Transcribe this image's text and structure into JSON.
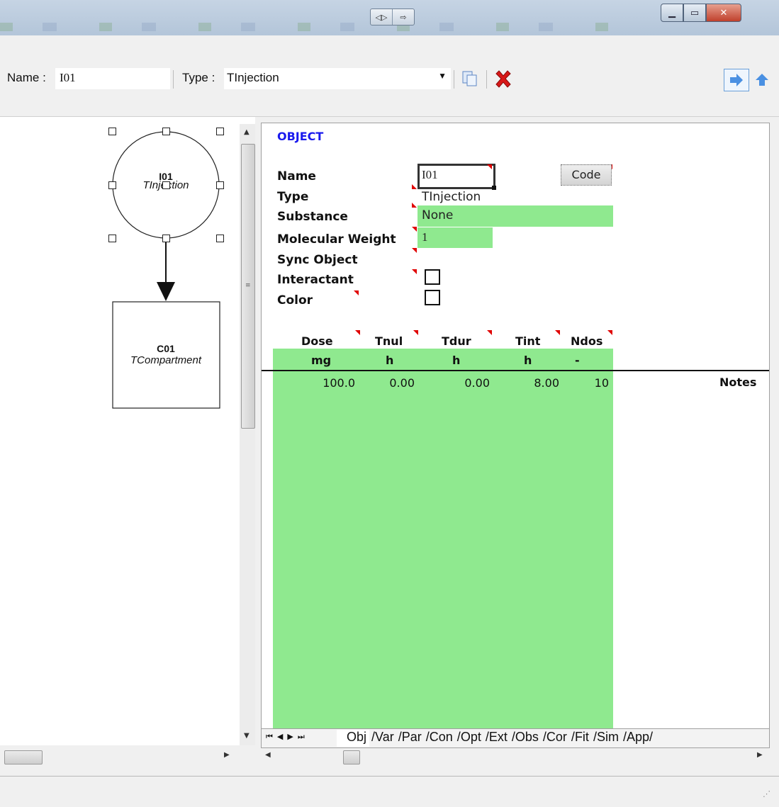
{
  "toolbar": {
    "name_label": "Name :",
    "name_value": "I01",
    "type_label": "Type :",
    "type_value": "TInjection"
  },
  "diagram": {
    "nodes": [
      {
        "id": "I01",
        "class": "TInjection"
      },
      {
        "id": "C01",
        "class": "TCompartment"
      }
    ]
  },
  "sheet": {
    "section": "OBJECT",
    "labels": {
      "name": "Name",
      "type": "Type",
      "substance": "Substance",
      "mw": "Molecular Weight",
      "sync": "Sync Object",
      "interactant": "Interactant",
      "color": "Color"
    },
    "values": {
      "name": "I01",
      "type": "TInjection",
      "substance": "None",
      "mw": "1"
    },
    "code_button": "Code",
    "dosing": {
      "headers": [
        "Dose",
        "Tnul",
        "Tdur",
        "Tint",
        "Ndos"
      ],
      "units": [
        "mg",
        "h",
        "h",
        "h",
        "-"
      ],
      "row": [
        "100.0",
        "0.00",
        "0.00",
        "8.00",
        "10"
      ]
    },
    "notes_label": "Notes"
  },
  "tabs": [
    "Obj",
    "Var",
    "Par",
    "Con",
    "Opt",
    "Ext",
    "Obs",
    "Cor",
    "Fit",
    "Sim",
    "App"
  ],
  "colors": {
    "cell_green": "#8fe98f",
    "section_blue": "#1a1aee",
    "close_red": "#cc1111"
  }
}
